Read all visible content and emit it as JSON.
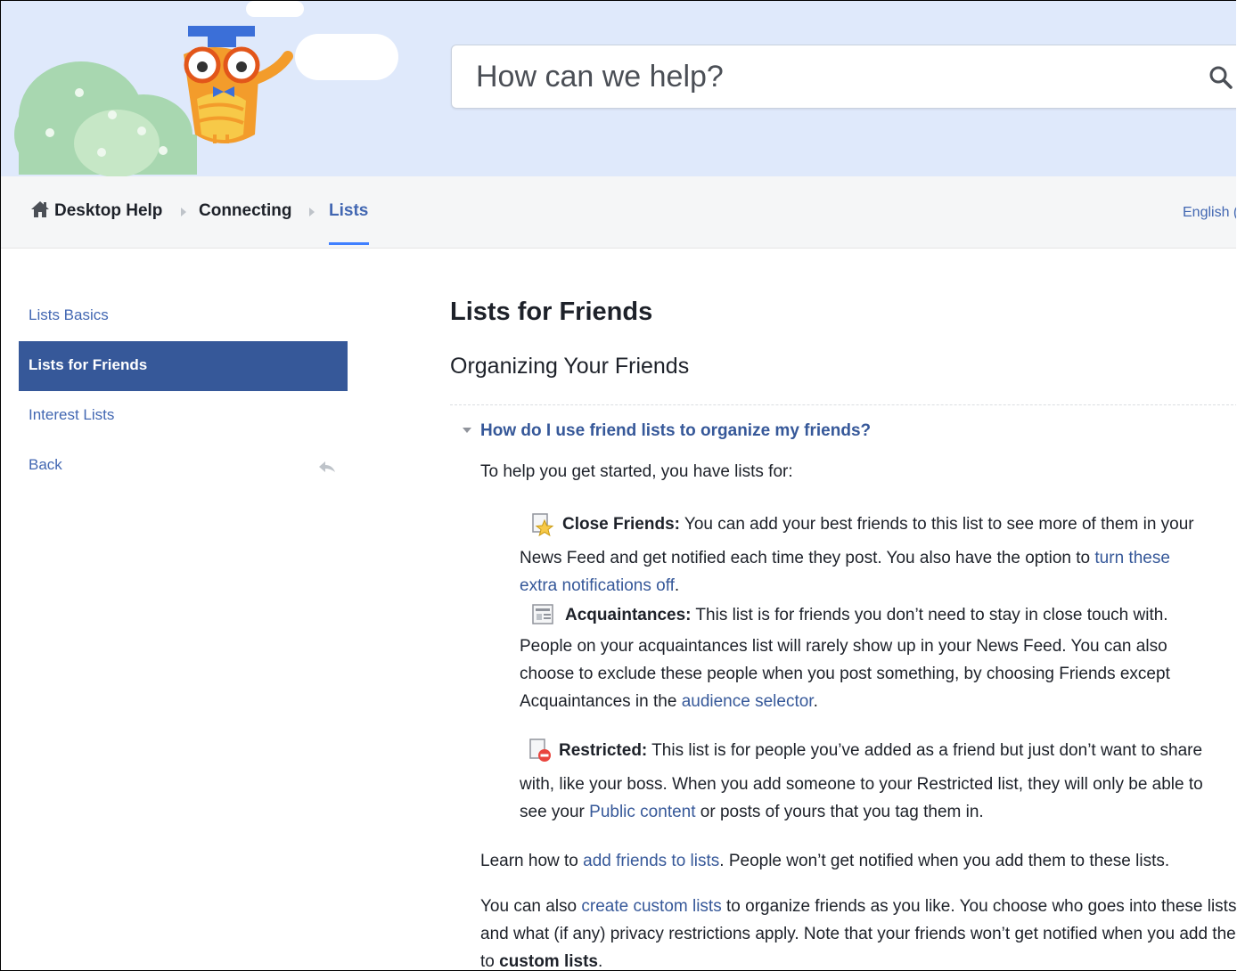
{
  "search": {
    "placeholder": "How can we help?"
  },
  "breadcrumb": {
    "items": [
      "Desktop Help",
      "Connecting",
      "Lists"
    ],
    "language": "English (US)"
  },
  "sidebar": {
    "items": [
      {
        "label": "Lists Basics"
      },
      {
        "label": "Lists for Friends",
        "selected": true
      },
      {
        "label": "Interest Lists"
      },
      {
        "label": "Back"
      }
    ]
  },
  "article": {
    "title": "Lists for Friends",
    "section": "Organizing Your Friends",
    "question": "How do I use friend lists to organize my friends?",
    "intro": "To help you get started, you have lists for:",
    "close_friends": {
      "term": "Close Friends:",
      "line1": " You can add your best friends to this list to see more of them in your",
      "line2": "News Feed and get notified each time they post. You also have the option to ",
      "link_a": "turn these",
      "link_b": "extra notifications off",
      "end": "."
    },
    "acquaintances": {
      "term": "Acquaintances:",
      "line1": " This list is for friends you don’t need to stay in close touch with.",
      "line2": "People on your acquaintances list will rarely show up in your News Feed. You can also",
      "line3": "choose to exclude these people when you post something, by choosing Friends except",
      "line4": "Acquaintances in the ",
      "link": "audience selector",
      "end": "."
    },
    "restricted": {
      "term": "Restricted:",
      "line1": " This list is for people you’ve added as a friend but just don’t want to share",
      "line2": "with, like your boss. When you add someone to your Restricted list, they will only be able to",
      "line3": "see your ",
      "link": "Public content",
      "line3_end": " or posts of yours that you tag them in."
    },
    "learn": {
      "pre": "Learn how to ",
      "link": "add friends to lists",
      "post": ". People won’t get notified when you add them to these lists."
    },
    "custom": {
      "pre": "You can also ",
      "link": "create custom lists",
      "post": " to organize friends as you like. You choose who goes into these lists",
      "line2": "and what (if any) privacy restrictions apply. Note that your friends won’t get notified when you add them",
      "line3_pre": "to ",
      "line3_bold": "custom lists",
      "line3_end": "."
    }
  },
  "colors": {
    "accent": "#4267b2",
    "selected_bg": "#365899",
    "hero_bg": "#dfe9fb"
  }
}
